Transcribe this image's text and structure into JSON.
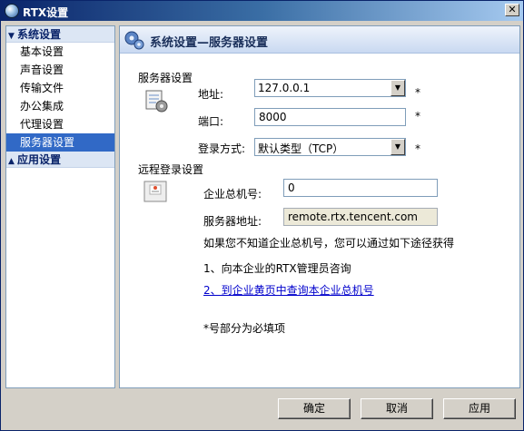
{
  "window": {
    "title": "RTX设置",
    "close_glyph": "✕"
  },
  "nav": {
    "groups": [
      {
        "label": "系统设置",
        "expanded": true,
        "items": [
          "基本设置",
          "声音设置",
          "传输文件",
          "办公集成",
          "代理设置",
          "服务器设置"
        ],
        "selected": "服务器设置"
      },
      {
        "label": "应用设置",
        "expanded": false
      }
    ]
  },
  "panel": {
    "title": "系统设置—服务器设置",
    "icon": "gears-icon",
    "server_section": {
      "label": "服务器设置",
      "address_label": "地址:",
      "address_value": "127.0.0.1",
      "port_label": "端口:",
      "port_value": "8000",
      "login_label": "登录方式:",
      "login_value": "默认类型（TCP）",
      "required_mark": "*"
    },
    "remote_section": {
      "label": "远程登录设置",
      "corp_id_label": "企业总机号:",
      "corp_id_value": "0",
      "server_addr_label": "服务器地址:",
      "server_addr_value": "remote.rtx.tencent.com",
      "hint": "如果您不知道企业总机号，您可以通过如下途径获得",
      "step1": "1、向本企业的RTX管理员咨询",
      "step2_link": "2、到企业黄页中查询本企业总机号",
      "required_note": "*号部分为必填项"
    }
  },
  "buttons": {
    "ok": "确定",
    "cancel": "取消",
    "apply": "应用"
  },
  "colors": {
    "title_bar": "#0a246a",
    "selected_item": "#3169c6",
    "link": "#0000cc"
  }
}
